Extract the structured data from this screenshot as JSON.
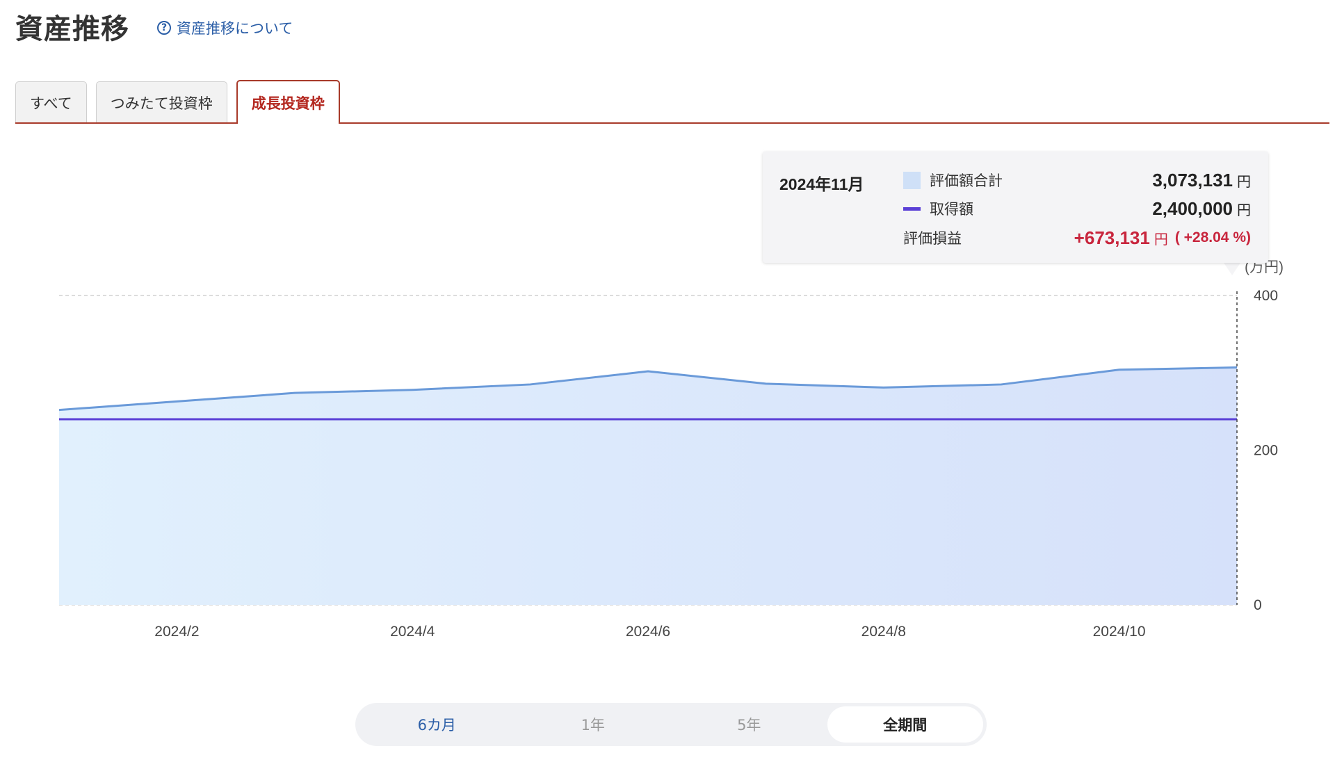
{
  "header": {
    "title": "資産推移",
    "help_link": "資産推移について"
  },
  "tabs": [
    {
      "label": "すべて"
    },
    {
      "label": "つみたて投資枠"
    },
    {
      "label": "成長投資枠",
      "active": true
    }
  ],
  "tooltip": {
    "date": "2024年11月",
    "valuation_label": "評価額合計",
    "valuation_value": "3,073,131",
    "cost_label": "取得額",
    "cost_value": "2,400,000",
    "pl_label": "評価損益",
    "pl_value": "+673,131",
    "pl_pct": "( +28.04 %)",
    "unit": "円"
  },
  "chart_data": {
    "type": "area",
    "x": [
      "2024/1",
      "2024/2",
      "2024/3",
      "2024/4",
      "2024/5",
      "2024/6",
      "2024/7",
      "2024/8",
      "2024/9",
      "2024/10",
      "2024/11"
    ],
    "x_tick_labels": [
      "2024/2",
      "2024/4",
      "2024/6",
      "2024/8",
      "2024/10"
    ],
    "y_unit_label": "(万円)",
    "y_tick_labels": [
      "400",
      "200",
      "0"
    ],
    "ylim": [
      0,
      400
    ],
    "grid": true,
    "series": [
      {
        "name": "評価額合計",
        "type": "area",
        "color": "#6a9ad9",
        "values": [
          252,
          263,
          274,
          278,
          285,
          302,
          286,
          281,
          285,
          304,
          307
        ]
      },
      {
        "name": "取得額",
        "type": "line",
        "color": "#5a3fd6",
        "values": [
          240,
          240,
          240,
          240,
          240,
          240,
          240,
          240,
          240,
          240,
          240
        ]
      }
    ]
  },
  "periods": [
    {
      "label": "6カ月"
    },
    {
      "label": "1年"
    },
    {
      "label": "5年"
    },
    {
      "label": "全期間",
      "active": true
    }
  ],
  "colors": {
    "accent": "#b3261e",
    "link": "#2b5ea7",
    "profit": "#c8253d"
  }
}
